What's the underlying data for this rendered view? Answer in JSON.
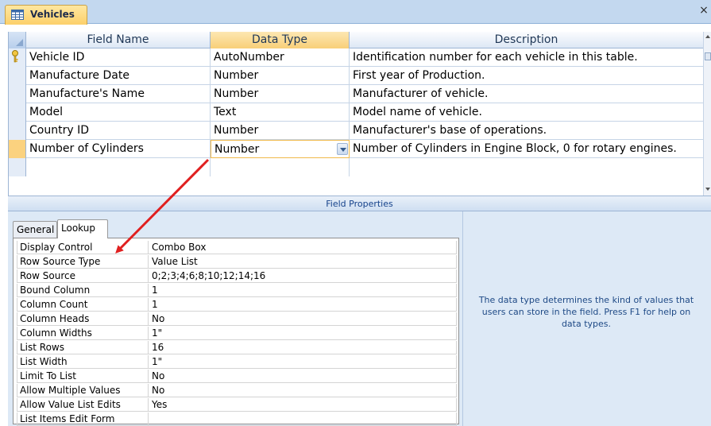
{
  "tab": {
    "title": "Vehicles",
    "close_glyph": "×"
  },
  "grid": {
    "headers": {
      "field_name": "Field Name",
      "data_type": "Data Type",
      "description": "Description"
    },
    "rows": [
      {
        "field_name": "Vehicle ID",
        "data_type": "AutoNumber",
        "description": "Identification number for each vehicle in this table.",
        "primary_key": true
      },
      {
        "field_name": "Manufacture Date",
        "data_type": "Number",
        "description": "First year of Production."
      },
      {
        "field_name": "Manufacture's Name",
        "data_type": "Number",
        "description": "Manufacturer of vehicle."
      },
      {
        "field_name": "Model",
        "data_type": "Text",
        "description": "Model name of vehicle."
      },
      {
        "field_name": "Country ID",
        "data_type": "Number",
        "description": "Manufacturer's base of operations."
      },
      {
        "field_name": "Number of Cylinders",
        "data_type": "Number",
        "description": "Number of Cylinders in Engine Block, 0 for rotary engines.",
        "current": true
      }
    ]
  },
  "field_properties": {
    "title": "Field Properties",
    "tabs": [
      "General",
      "Lookup"
    ],
    "active_tab": "Lookup",
    "properties": [
      {
        "name": "Display Control",
        "value": "Combo Box"
      },
      {
        "name": "Row Source Type",
        "value": "Value List"
      },
      {
        "name": "Row Source",
        "value": "0;2;3;4;6;8;10;12;14;16"
      },
      {
        "name": "Bound Column",
        "value": "1"
      },
      {
        "name": "Column Count",
        "value": "1"
      },
      {
        "name": "Column Heads",
        "value": "No"
      },
      {
        "name": "Column Widths",
        "value": "1\""
      },
      {
        "name": "List Rows",
        "value": "16"
      },
      {
        "name": "List Width",
        "value": "1\""
      },
      {
        "name": "Limit To List",
        "value": "No"
      },
      {
        "name": "Allow Multiple Values",
        "value": "No"
      },
      {
        "name": "Allow Value List Edits",
        "value": "Yes"
      },
      {
        "name": "List Items Edit Form",
        "value": ""
      }
    ],
    "help_text": "The data type determines the kind of values that users can store in the field.  Press F1 for help on data types."
  },
  "icons": {
    "table_icon": "table-icon",
    "key_icon": "primary-key-icon",
    "dropdown_icon": "chevron-down-icon",
    "annotation_arrow": "red-arrow-annotation"
  },
  "colors": {
    "tab_active": "#fcd06a",
    "header_active": "#f8cf78",
    "current_row_selector": "#fbd27f",
    "help_text": "#1f4a86",
    "annotation_arrow": "#e02020"
  }
}
